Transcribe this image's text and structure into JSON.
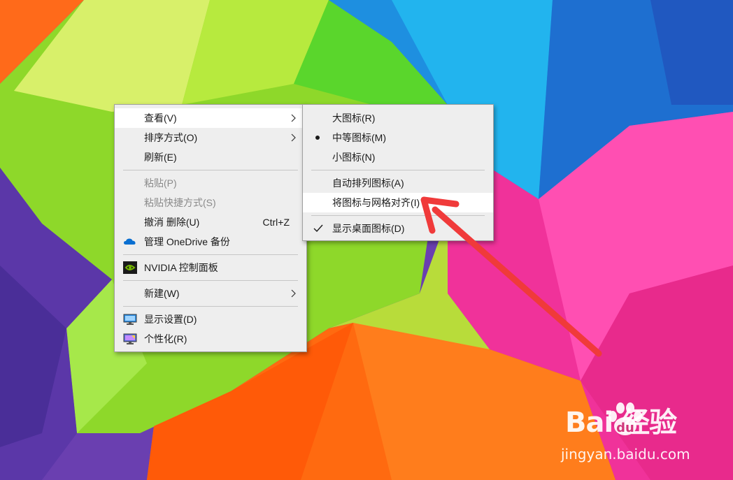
{
  "main_menu": {
    "items": [
      {
        "label": "查看(V)",
        "has_submenu": true
      },
      {
        "label": "排序方式(O)",
        "has_submenu": true
      },
      {
        "label": "刷新(E)"
      },
      {
        "label": "粘贴(P)",
        "disabled": true
      },
      {
        "label": "粘贴快捷方式(S)",
        "disabled": true
      },
      {
        "label": "撤消 删除(U)",
        "shortcut": "Ctrl+Z"
      },
      {
        "label": "管理 OneDrive 备份",
        "icon": "onedrive-cloud-icon"
      },
      {
        "label": "NVIDIA 控制面板",
        "icon": "nvidia-icon"
      },
      {
        "label": "新建(W)",
        "has_submenu": true
      },
      {
        "label": "显示设置(D)",
        "icon": "display-icon"
      },
      {
        "label": "个性化(R)",
        "icon": "personalize-icon"
      }
    ]
  },
  "view_submenu": {
    "items": [
      {
        "label": "大图标(R)"
      },
      {
        "label": "中等图标(M)",
        "selected": true
      },
      {
        "label": "小图标(N)"
      },
      {
        "label": "自动排列图标(A)"
      },
      {
        "label": "将图标与网格对齐(I)",
        "highlighted": true
      },
      {
        "label": "显示桌面图标(D)",
        "checked": true
      }
    ]
  },
  "watermark": {
    "logo": "Bai  经验",
    "url": "jingyan.baidu.com"
  },
  "colors": {
    "menu_bg": "#eeeeee",
    "annotation_arrow": "#f03a3a",
    "onedrive": "#0a6fd1",
    "nvidia": "#76b900"
  }
}
